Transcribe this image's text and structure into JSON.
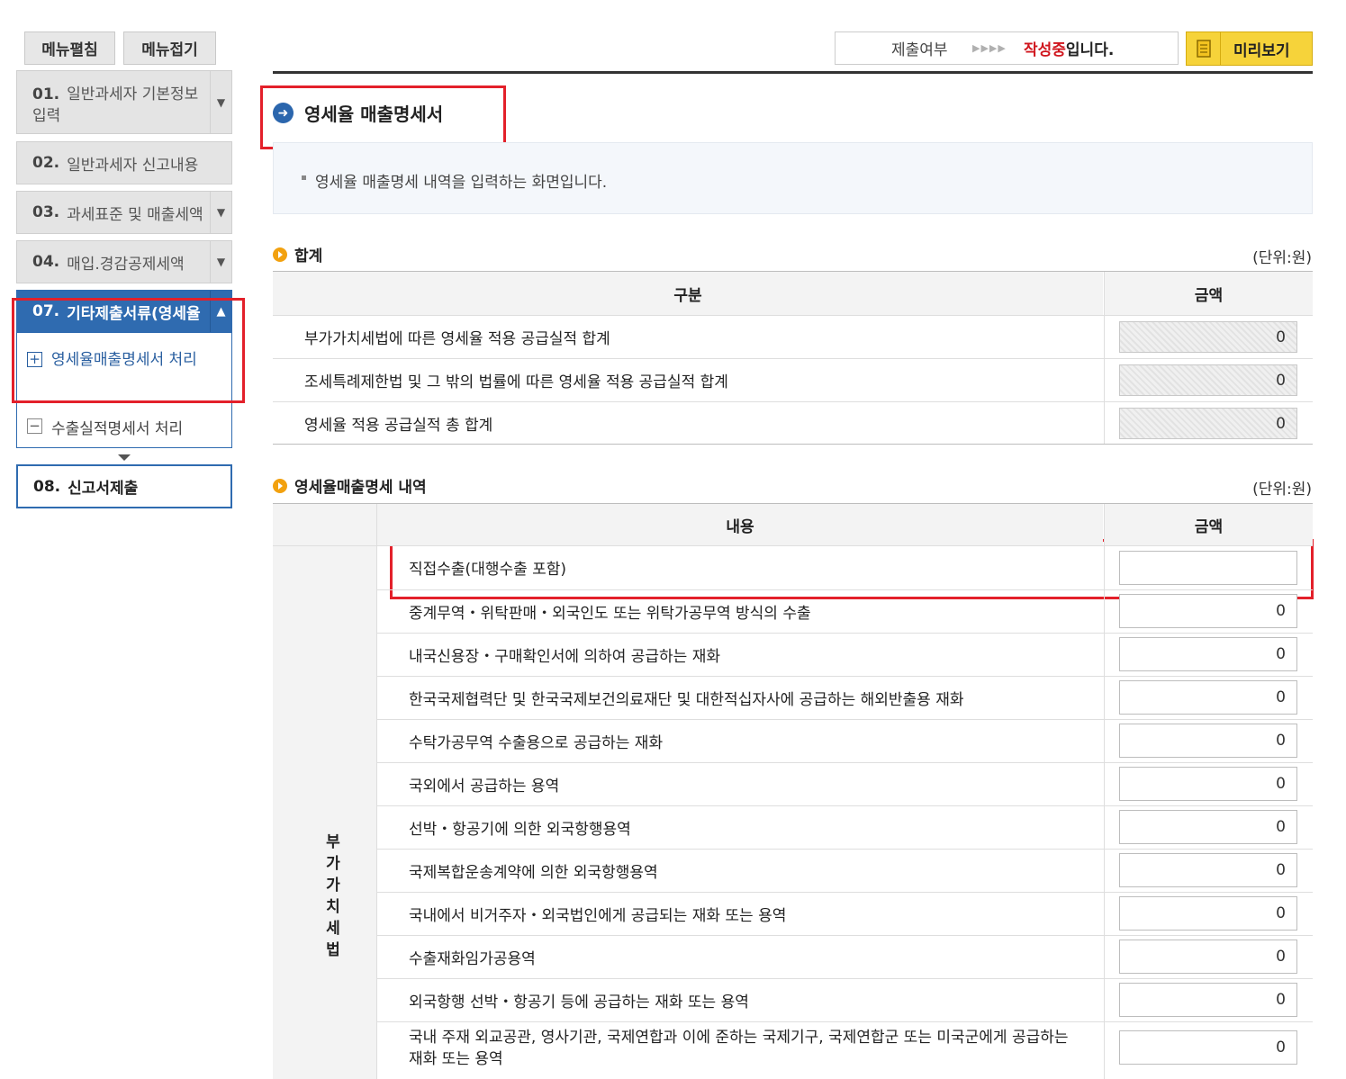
{
  "menu": {
    "expand_label": "메뉴펼침",
    "collapse_label": "메뉴접기",
    "steps": [
      {
        "num": "01.",
        "label": "일반과세자 기본정보 입력"
      },
      {
        "num": "02.",
        "label": "일반과세자 신고내용"
      },
      {
        "num": "03.",
        "label": "과세표준 및 매출세액"
      },
      {
        "num": "04.",
        "label": "매입.경감공제세액"
      },
      {
        "num": "07.",
        "label": "기타제출서류(영세율"
      },
      {
        "num": "08.",
        "label": "신고서제출"
      }
    ],
    "sub_items": [
      {
        "symbol": "+",
        "label": "영세율매출명세서 처리"
      },
      {
        "symbol": "−",
        "label": "수출실적명세서 처리"
      }
    ]
  },
  "status": {
    "label": "제출여부",
    "arrows": "▶▶▶▶",
    "state_red": "작성중",
    "state_suffix": "입니다."
  },
  "preview_button": "미리보기",
  "page": {
    "title": "영세율 매출명세서",
    "description": "영세율 매출명세 내역을 입력하는 화면입니다."
  },
  "summary": {
    "heading": "합계",
    "unit": "(단위:원)",
    "col_category": "구분",
    "col_amount": "금액",
    "rows": [
      {
        "label": "부가가치세법에 따른 영세율 적용 공급실적 합계",
        "value": "0"
      },
      {
        "label": "조세특례제한법 및 그 밖의 법률에 따른 영세율 적용 공급실적 합계",
        "value": "0"
      },
      {
        "label": "영세율 적용 공급실적 총 합계",
        "value": "0"
      }
    ]
  },
  "details": {
    "heading": "영세율매출명세 내역",
    "unit": "(단위:원)",
    "col_content": "내용",
    "col_amount": "금액",
    "category_label": "부가가치세법",
    "category_chars": [
      "부",
      "가",
      "가",
      "치",
      "세",
      "법"
    ],
    "rows": [
      {
        "label": "직접수출(대행수출 포함)",
        "value": ""
      },
      {
        "label": "중계무역・위탁판매・외국인도 또는 위탁가공무역 방식의 수출",
        "value": "0"
      },
      {
        "label": "내국신용장・구매확인서에 의하여 공급하는 재화",
        "value": "0"
      },
      {
        "label": "한국국제협력단 및 한국국제보건의료재단 및 대한적십자사에 공급하는 해외반출용 재화",
        "value": "0"
      },
      {
        "label": "수탁가공무역 수출용으로 공급하는 재화",
        "value": "0"
      },
      {
        "label": "국외에서 공급하는 용역",
        "value": "0"
      },
      {
        "label": "선박・항공기에 의한 외국항행용역",
        "value": "0"
      },
      {
        "label": "국제복합운송계약에 의한 외국항행용역",
        "value": "0"
      },
      {
        "label": "국내에서 비거주자・외국법인에게 공급되는 재화 또는 용역",
        "value": "0"
      },
      {
        "label": "수출재화임가공용역",
        "value": "0"
      },
      {
        "label": "외국항행 선박・항공기 등에 공급하는 재화 또는 용역",
        "value": "0"
      },
      {
        "label": "국내 주재 외교공관, 영사기관, 국제연합과 이에 준하는 국제기구, 국제연합군 또는 미국군에게 공급하는 재화 또는 용역",
        "value": "0"
      }
    ]
  }
}
